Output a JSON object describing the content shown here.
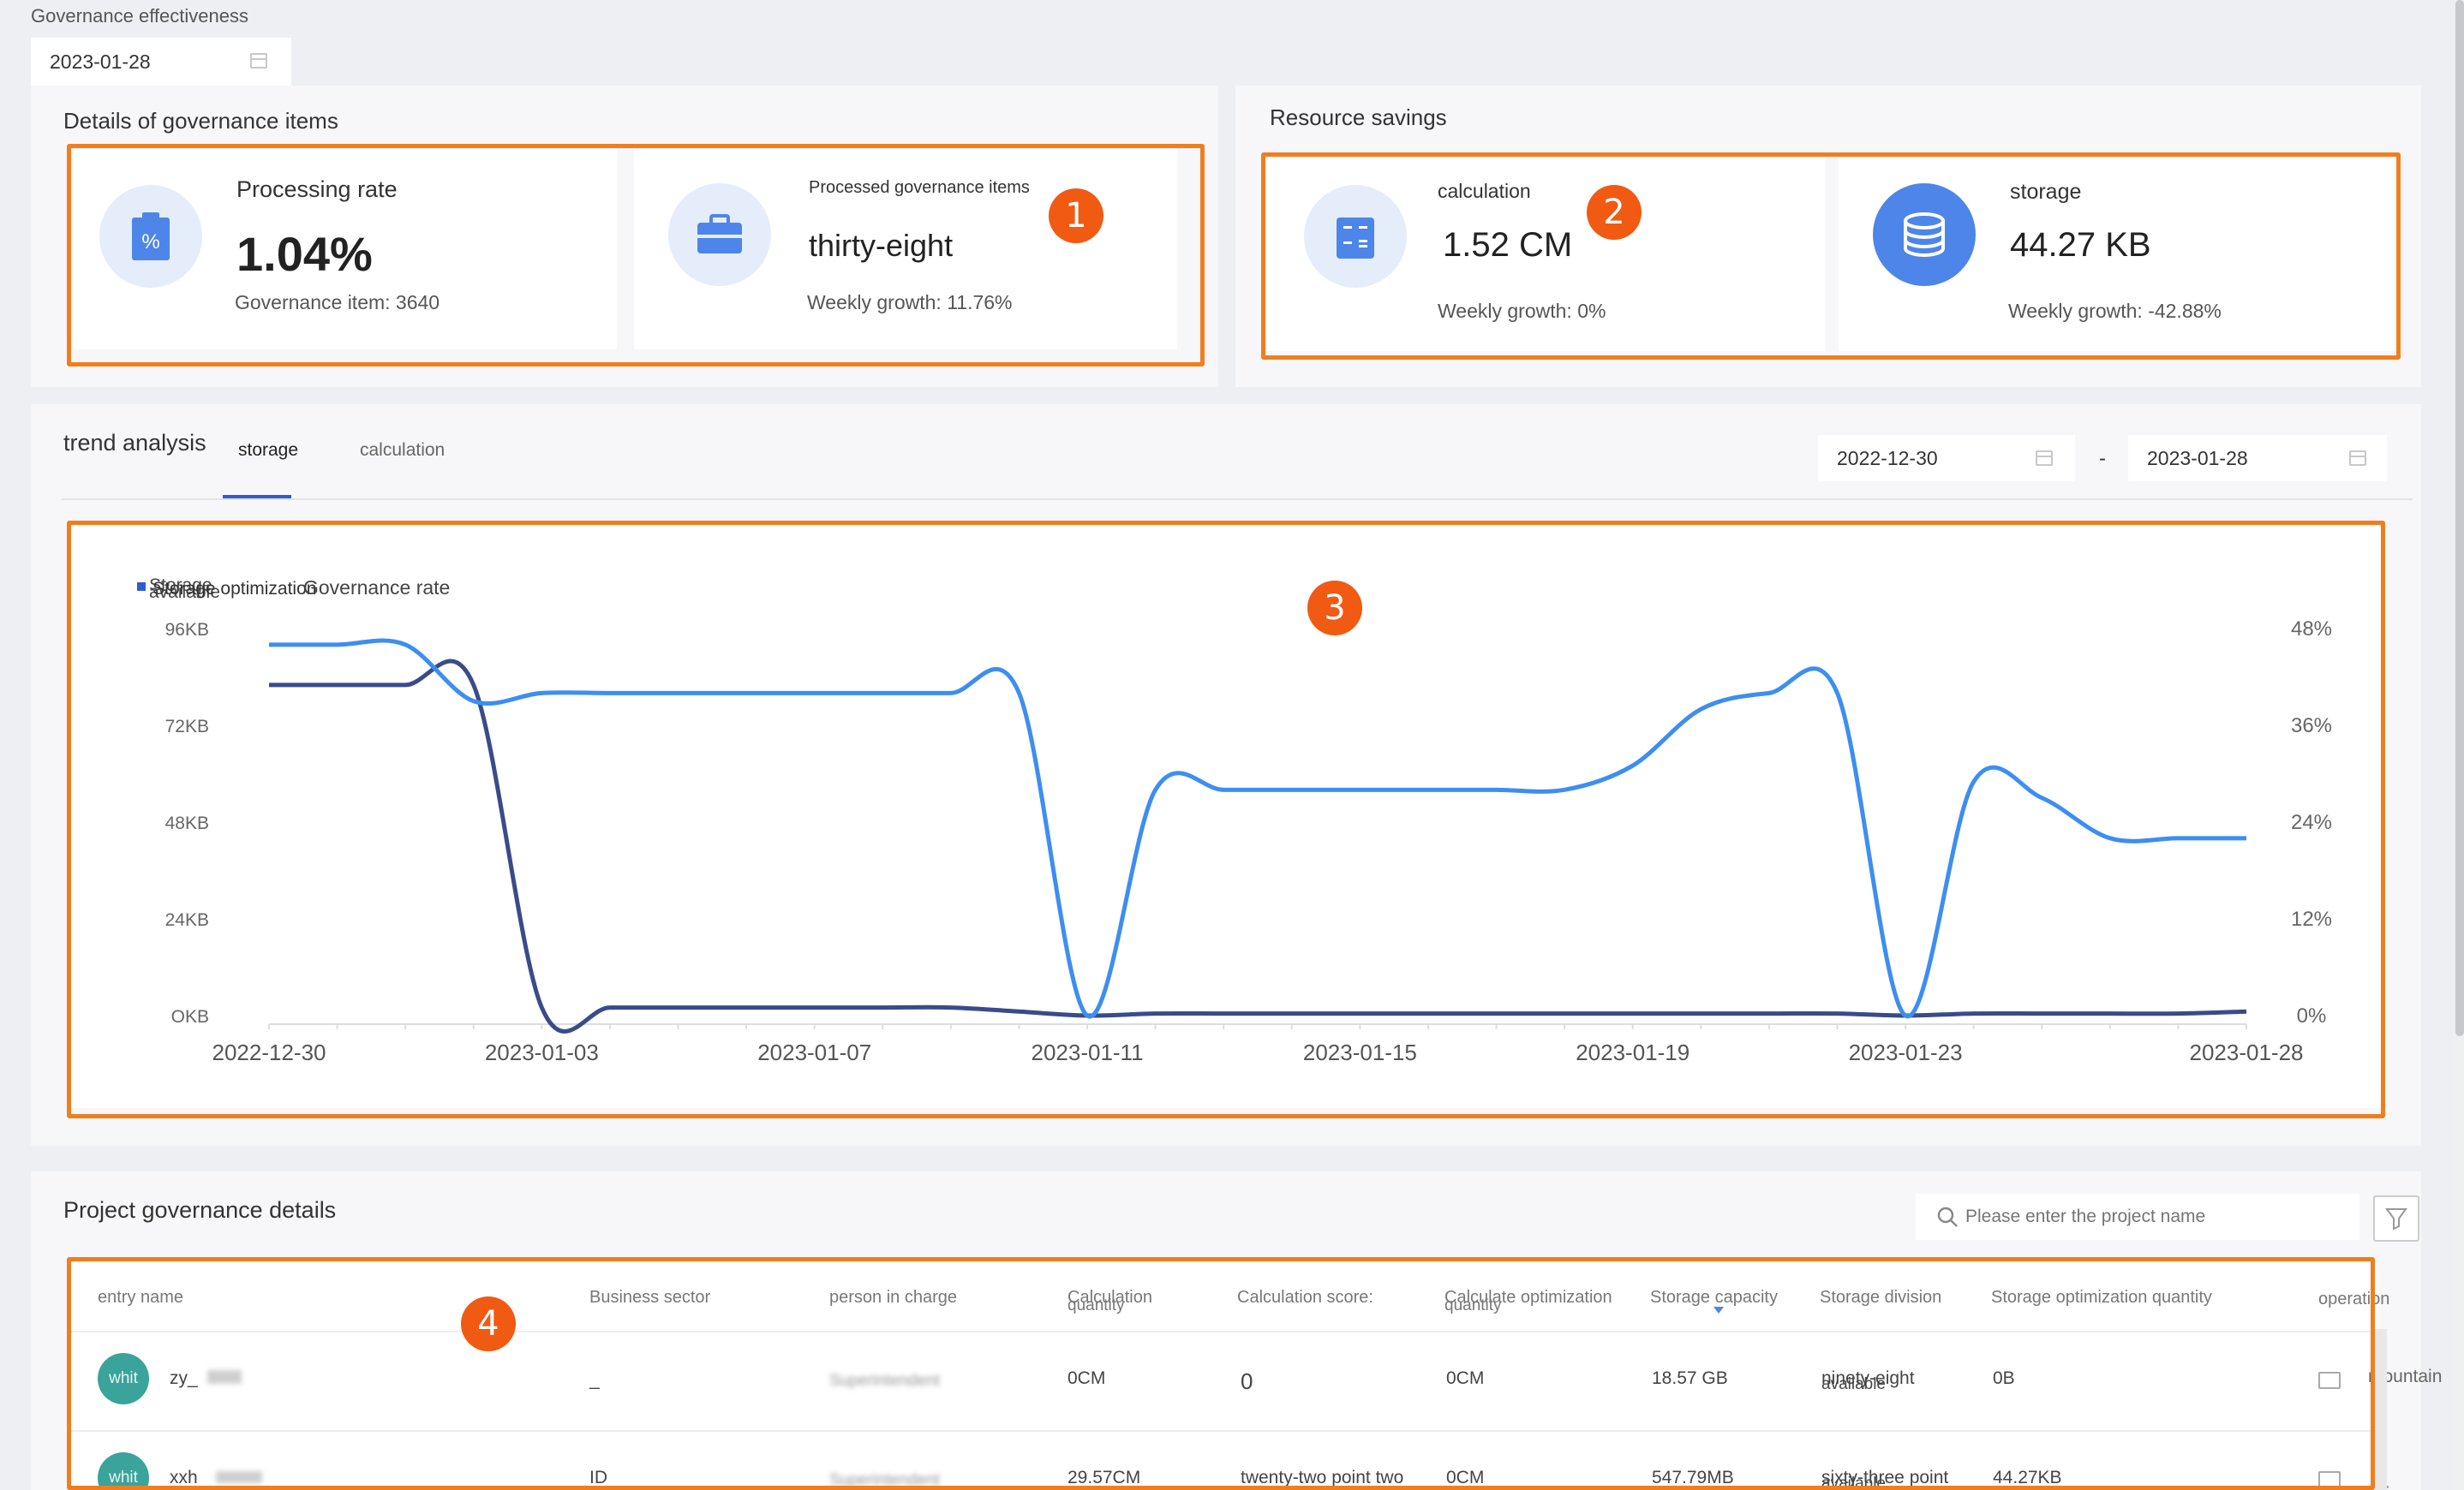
{
  "page": {
    "title": "Governance effectiveness",
    "date": "2023-01-28"
  },
  "details": {
    "title": "Details of governance items",
    "processing": {
      "label": "Processing rate",
      "value": "1.04%",
      "sub": "Governance item: 3640",
      "icon": "percent-clipboard-icon"
    },
    "processed": {
      "label": "Processed governance items",
      "value": "thirty-eight",
      "sub": "Weekly growth: 11.76%",
      "icon": "briefcase-icon"
    }
  },
  "savings": {
    "title": "Resource savings",
    "calculation": {
      "label": "calculation",
      "value": "1.52 CM",
      "sub": "Weekly growth: 0%",
      "icon": "calculator-icon"
    },
    "storage": {
      "label": "storage",
      "value": "44.27 KB",
      "sub": "Weekly growth: -42.88%",
      "icon": "database-icon"
    }
  },
  "trend": {
    "title": "trend analysis",
    "tabs": [
      "storage",
      "calculation"
    ],
    "active_tab": "storage",
    "date_from": "2022-12-30",
    "date_sep": "-",
    "date_to": "2023-01-28",
    "legend": [
      "Storage optimization",
      "Governance rate"
    ],
    "legend_overlap": "Storage",
    "legend_overlap2": "available"
  },
  "chart_data": {
    "type": "line",
    "x": [
      "2022-12-30",
      "2022-12-31",
      "2023-01-01",
      "2023-01-02",
      "2023-01-03",
      "2023-01-04",
      "2023-01-05",
      "2023-01-06",
      "2023-01-07",
      "2023-01-08",
      "2023-01-09",
      "2023-01-10",
      "2023-01-11",
      "2023-01-12",
      "2023-01-13",
      "2023-01-14",
      "2023-01-15",
      "2023-01-16",
      "2023-01-17",
      "2023-01-18",
      "2023-01-19",
      "2023-01-20",
      "2023-01-21",
      "2023-01-22",
      "2023-01-23",
      "2023-01-24",
      "2023-01-25",
      "2023-01-26",
      "2023-01-27",
      "2023-01-28"
    ],
    "x_ticks": [
      "2022-12-30",
      "2023-01-03",
      "2023-01-07",
      "2023-01-11",
      "2023-01-15",
      "2023-01-19",
      "2023-01-23",
      "2023-01-28"
    ],
    "y_left_ticks": [
      "96KB",
      "72KB",
      "48KB",
      "24KB",
      "OKB"
    ],
    "y_right_ticks": [
      "48%",
      "36%",
      "24%",
      "12%",
      "0%"
    ],
    "ylim_left": [
      0,
      96
    ],
    "ylim_right": [
      0,
      48
    ],
    "series": [
      {
        "name": "Storage optimization",
        "axis": "left",
        "color": "#3a4b8a",
        "values": [
          82,
          82,
          82,
          82,
          2,
          2,
          2,
          2,
          2,
          2,
          2,
          1,
          0,
          0.5,
          0.5,
          0.5,
          0.5,
          0.5,
          0.5,
          0.5,
          0.5,
          0.5,
          0.5,
          0.5,
          0,
          0.5,
          0.5,
          0.5,
          0.5,
          1
        ]
      },
      {
        "name": "Governance rate",
        "axis": "right",
        "color": "#3d8ef0",
        "values": [
          46,
          46,
          46,
          39,
          40,
          40,
          40,
          40,
          40,
          40,
          40,
          40,
          0,
          28,
          28,
          28,
          28,
          28,
          28,
          28,
          31,
          38,
          40,
          40,
          0,
          29,
          27,
          22,
          22,
          22
        ]
      }
    ],
    "grid": false,
    "legend_position": "top-left"
  },
  "project": {
    "title": "Project governance details",
    "search_placeholder": "Please enter the project name",
    "filter_icon": "filter-icon",
    "columns": [
      "entry name",
      "Business sector",
      "person in charge",
      "Calculation",
      "Calculation score:",
      "Calculate optimization",
      "Storage capacity",
      "Storage division",
      "Storage optimization quantity",
      "operation"
    ],
    "col_overlap": [
      "quantity",
      "quantity"
    ],
    "rows": [
      {
        "avatar": "whit",
        "name": "zy_",
        "sector": "_",
        "person": "Superintendent",
        "calc_qty": "0CM",
        "calc_score": "0",
        "calc_opt": "0CM",
        "storage_cap": "18.57 GB",
        "storage_div": "ninety-eight",
        "storage_div_overlap": "available",
        "storage_opt": "0B",
        "op": "mountain"
      },
      {
        "avatar": "whit",
        "name": "xxh",
        "sector": "ID",
        "person": "Superintendent",
        "calc_qty": "29.57CM",
        "calc_score": "twenty-two point two",
        "calc_opt": "0CM",
        "storage_cap": "547.79MB",
        "storage_div": "sixty-three point",
        "storage_div_overlap": "available",
        "storage_opt": "44.27KB",
        "op": ""
      }
    ]
  },
  "badges": [
    "1",
    "2",
    "3",
    "4"
  ]
}
